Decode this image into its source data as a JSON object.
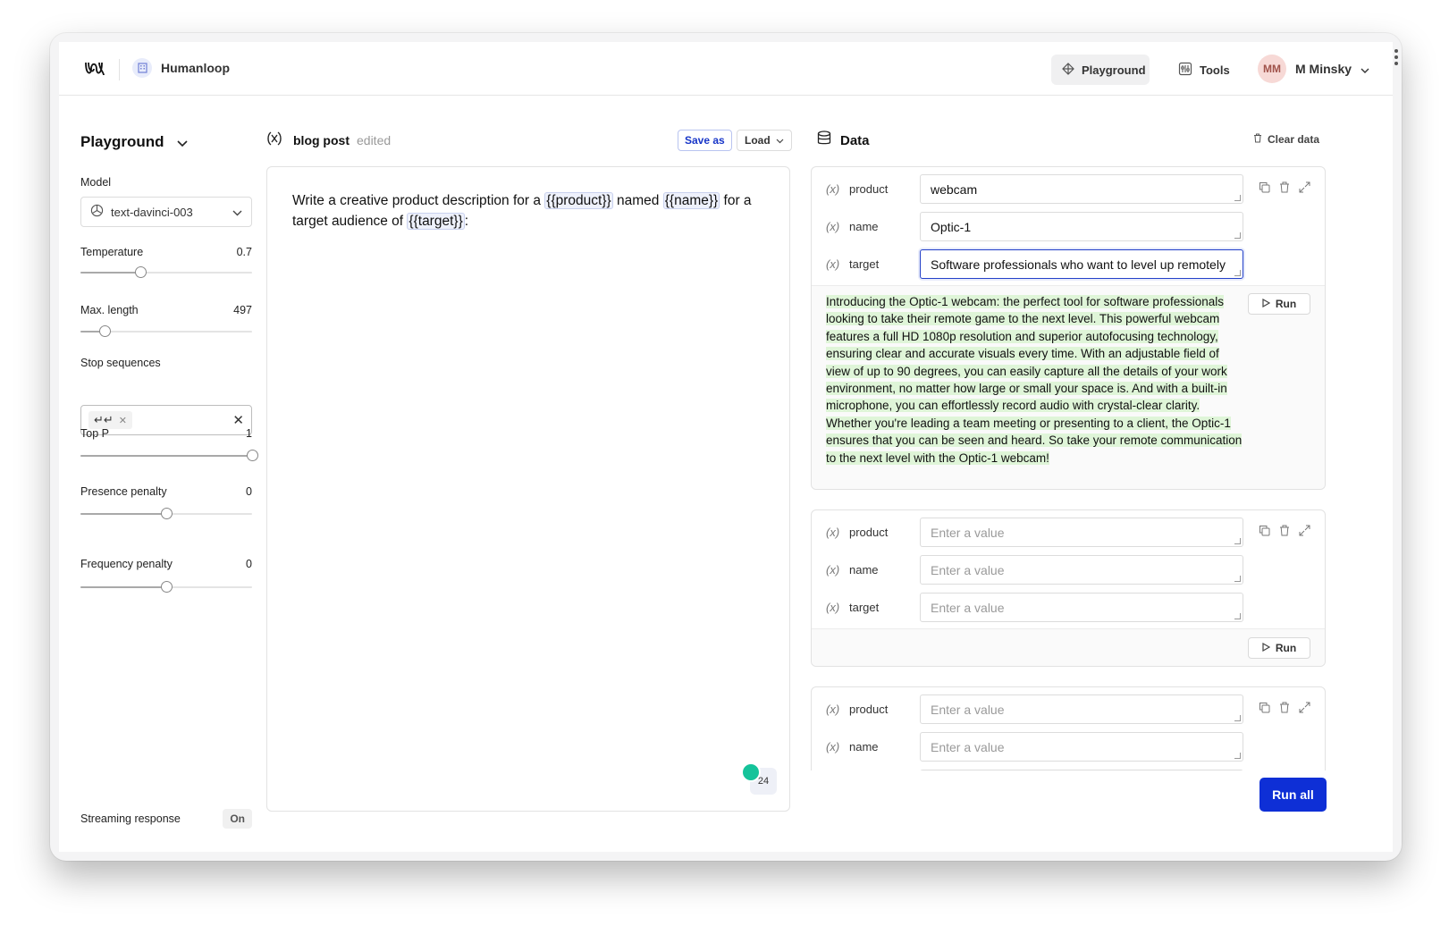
{
  "header": {
    "org_name": "Humanloop",
    "nav": [
      {
        "label": "Playground",
        "icon": "diamond-icon"
      },
      {
        "label": "Tools",
        "icon": "tools-icon"
      }
    ],
    "user": {
      "initials": "MM",
      "name": "M Minsky"
    }
  },
  "sidebar": {
    "title": "Playground",
    "model_label": "Model",
    "model_value": "text-davinci-003",
    "params": [
      {
        "label": "Temperature",
        "value": "0.7",
        "fraction": 0.35
      },
      {
        "label": "Max. length",
        "value": "497",
        "fraction": 0.14
      },
      {
        "label": "Top P",
        "value": "1",
        "fraction": 1.0
      },
      {
        "label": "Presence penalty",
        "value": "0",
        "fraction": 0.5
      },
      {
        "label": "Frequency penalty",
        "value": "0",
        "fraction": 0.5
      }
    ],
    "stop_label": "Stop sequences",
    "stop_chip": "↵↵",
    "streaming_label": "Streaming response",
    "streaming_value": "On"
  },
  "editor": {
    "prompt_name": "blog post",
    "prompt_state": "edited",
    "save_label": "Save as",
    "load_label": "Load",
    "text_parts": {
      "p1": "Write a creative product description for a ",
      "v1": "{{product}}",
      "p2": " named ",
      "v2": "{{name}}",
      "p3": " for a target audience of ",
      "v3": "{{target}}",
      "p4": ":"
    },
    "token_count": "24"
  },
  "data": {
    "title": "Data",
    "clear_label": "Clear data",
    "var_symbol": "(x)",
    "placeholder": "Enter a value",
    "run_label": "Run",
    "run_all_label": "Run all",
    "cards": [
      {
        "rows": [
          {
            "name": "product",
            "value": "webcam"
          },
          {
            "name": "name",
            "value": "Optic-1"
          },
          {
            "name": "target",
            "value": "Software professionals who want to level up remotely"
          }
        ],
        "output": "Introducing the Optic-1 webcam: the perfect tool for software professionals looking to take their remote game to the next level. This powerful webcam features a full HD 1080p resolution and superior autofocusing technology, ensuring clear and accurate visuals every time. With an adjustable field of view of up to 90 degrees, you can easily capture all the details of your work environment, no matter how large or small your space is. And with a built-in microphone, you can effortlessly record audio with crystal-clear clarity. Whether you're leading a team meeting or presenting to a client, the Optic-1 ensures that you can be seen and heard. So take your remote communication to the next level with the Optic-1 webcam!"
      },
      {
        "rows": [
          {
            "name": "product",
            "value": ""
          },
          {
            "name": "name",
            "value": ""
          },
          {
            "name": "target",
            "value": ""
          }
        ]
      },
      {
        "rows": [
          {
            "name": "product",
            "value": ""
          },
          {
            "name": "name",
            "value": ""
          }
        ]
      }
    ]
  },
  "colors": {
    "accent": "#0e2fd6",
    "output_highlight": "#dff5d8",
    "var_token_bg": "#eef1fb"
  }
}
